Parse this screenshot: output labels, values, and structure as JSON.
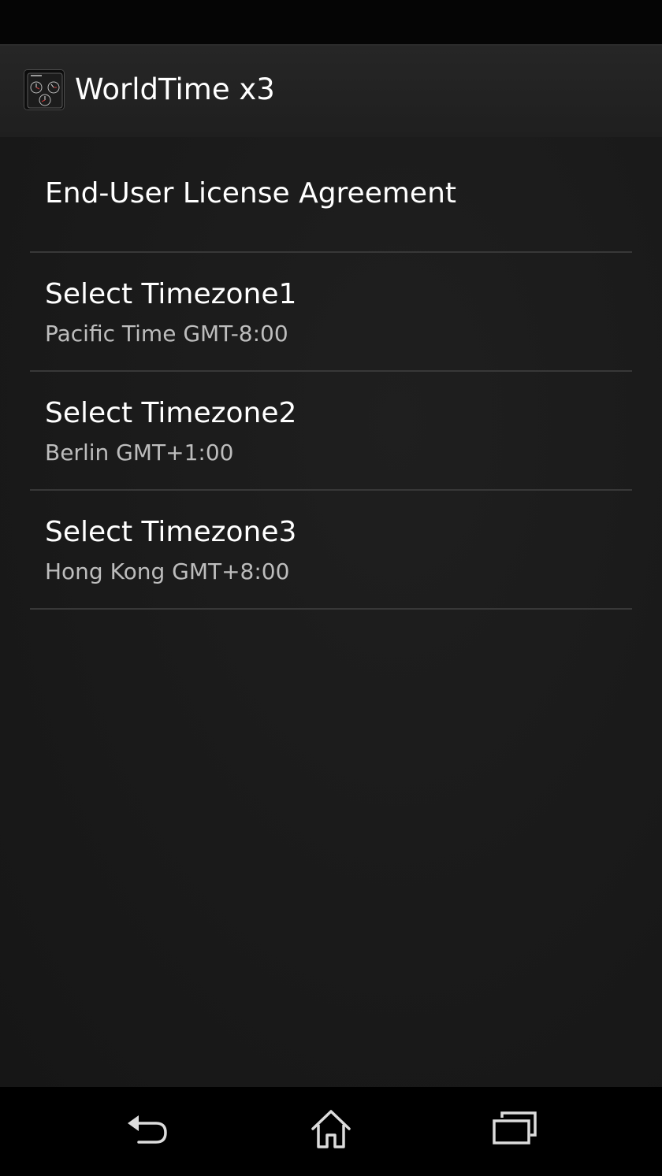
{
  "app": {
    "title": "WorldTime x3",
    "icon": "worldtime-app-icon"
  },
  "preferences": [
    {
      "title": "End-User License Agreement",
      "summary": ""
    },
    {
      "title": "Select Timezone1",
      "summary": "Pacific Time GMT-8:00"
    },
    {
      "title": "Select Timezone2",
      "summary": "Berlin GMT+1:00"
    },
    {
      "title": "Select Timezone3",
      "summary": "Hong Kong GMT+8:00"
    }
  ],
  "navigation": {
    "back_icon": "back-icon",
    "home_icon": "home-icon",
    "recents_icon": "recent-apps-icon"
  },
  "colors": {
    "background": "#1b1b1b",
    "divider": "#383838",
    "title_text": "#ffffff",
    "summary_text": "#bdbdbd"
  }
}
